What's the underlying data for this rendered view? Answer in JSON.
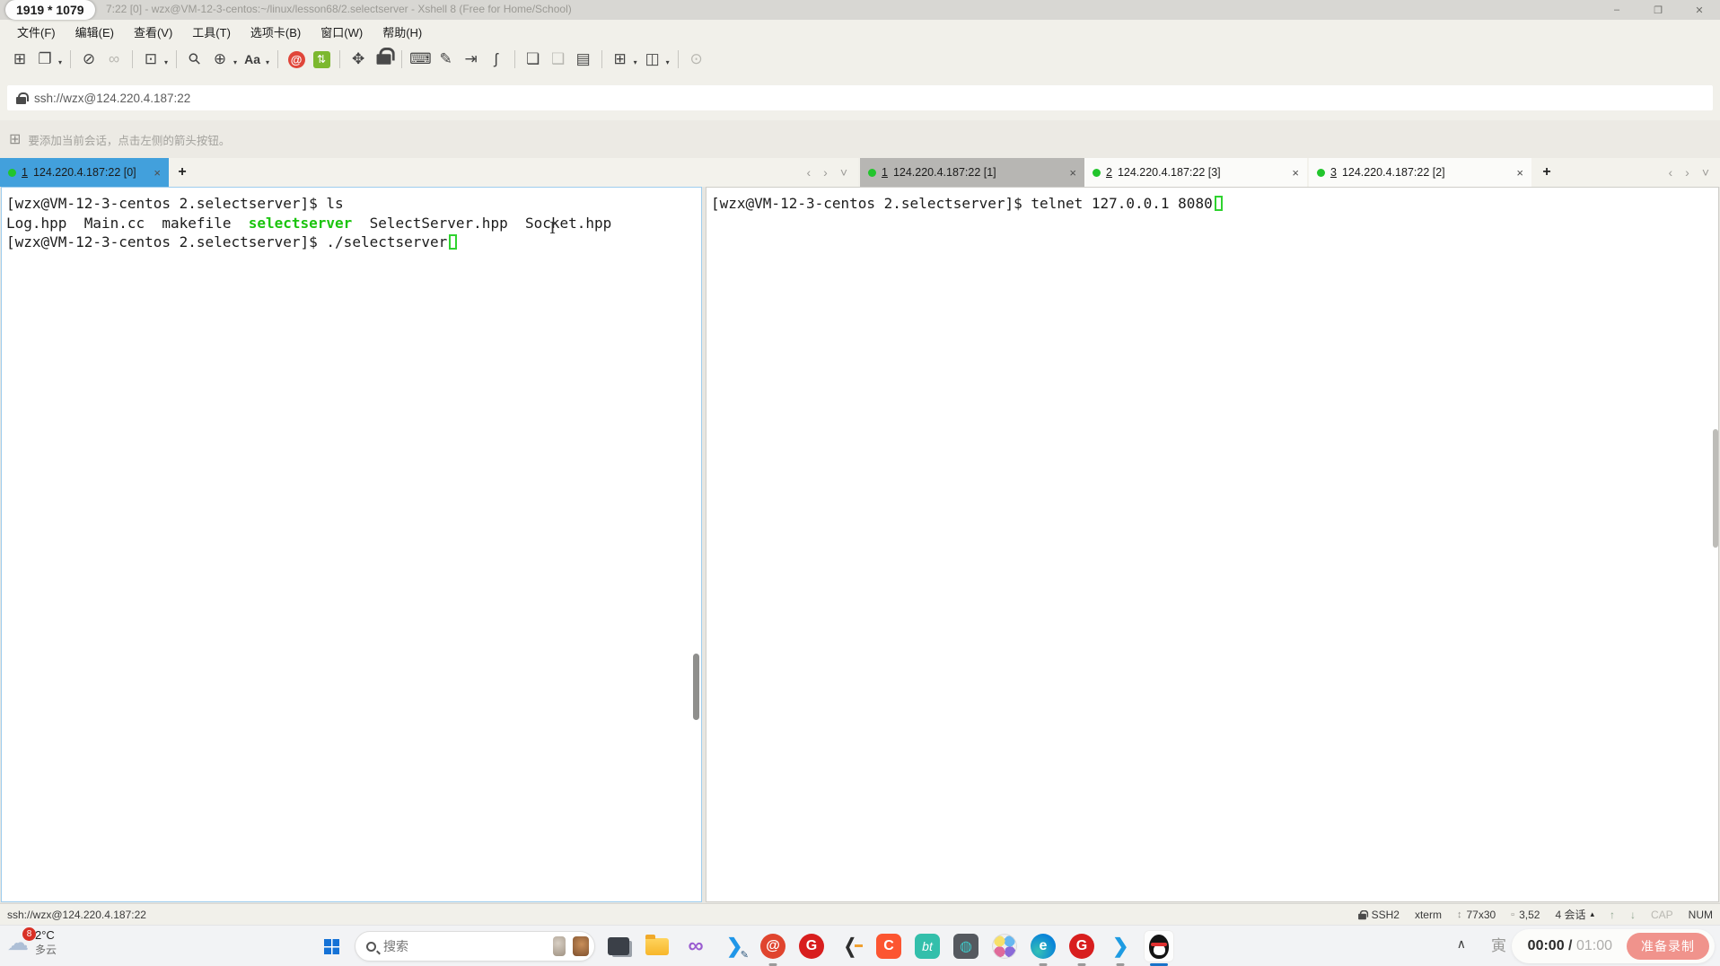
{
  "overlay": {
    "resolution_badge": "1919 * 1079"
  },
  "titlebar": {
    "title": "7:22 [0] - wzx@VM-12-3-centos:~/linux/lesson68/2.selectserver - Xshell 8 (Free for Home/School)",
    "minimize": "–",
    "restore": "❐",
    "close": "✕"
  },
  "menubar": {
    "items": [
      "文件(F)",
      "编辑(E)",
      "查看(V)",
      "工具(T)",
      "选项卡(B)",
      "窗口(W)",
      "帮助(H)"
    ]
  },
  "toolbar": {
    "caret": "▾",
    "glyphs": {
      "new_session": "⊞",
      "open_sessions": "❐",
      "disconnect": "⊘",
      "reconnect": "∞",
      "session_dialog": "⊡",
      "find": "⚲",
      "encoding": "⊕",
      "font": "Aa",
      "xshell_logo": "@",
      "xftp": "⇅",
      "fullscreen": "✥",
      "keyboard": "⌨",
      "highlight": "✎",
      "send_text": "⇥",
      "scroll": "ʃ",
      "log_start": "❏",
      "log_stop": "❑",
      "log_view": "▤",
      "new_tab_group": "⊞",
      "split_layout": "◫",
      "chat": "⊙"
    }
  },
  "addressbar": {
    "url": "ssh://wzx@124.220.4.187:22"
  },
  "infobar": {
    "icon_glyph": "⊞",
    "text": "要添加当前会话，点击左侧的箭头按钮。"
  },
  "tab_nav": {
    "add": "+",
    "close": "×",
    "prev": "‹",
    "next": "›",
    "menu": "˅"
  },
  "left_group": {
    "tabs": [
      {
        "num": "1",
        "label": "124.220.4.187:22 [0]"
      }
    ],
    "terminal": {
      "line1": "[wzx@VM-12-3-centos 2.selectserver]$ ls",
      "line2_pre": "Log.hpp  Main.cc  makefile  ",
      "line2_green": "selectserver",
      "line2_post": "  SelectServer.hpp  Socket.hpp",
      "line3": "[wzx@VM-12-3-centos 2.selectserver]$ ./selectserver"
    }
  },
  "right_group": {
    "tabs": [
      {
        "num": "1",
        "label": "124.220.4.187:22 [1]"
      },
      {
        "num": "2",
        "label": "124.220.4.187:22 [3]"
      },
      {
        "num": "3",
        "label": "124.220.4.187:22 [2]"
      }
    ],
    "terminal": {
      "line1": "[wzx@VM-12-3-centos 2.selectserver]$ telnet 127.0.0.1 8080"
    }
  },
  "statusbar": {
    "url": "ssh://wzx@124.220.4.187:22",
    "protocol": "SSH2",
    "terminal_type": "xterm",
    "screen_size": "77x30",
    "cursor_position": "3,52",
    "session_count": "4 会话",
    "caret": "▴",
    "font_up": "↑",
    "font_down": "↓",
    "caps": "CAP",
    "num": "NUM",
    "icons": {
      "resize": "↕",
      "position": "▫"
    }
  },
  "taskbar": {
    "weather": {
      "badge": "8",
      "temperature": "2°C",
      "condition": "多云",
      "cloud_glyph": "☁"
    },
    "search": {
      "placeholder": "搜索"
    },
    "icons": {
      "visual_studio": "∞",
      "vscode_pencil": "❮",
      "pencil": "✎",
      "xshell": "@",
      "gitee": "G",
      "leetcode": "❬",
      "csdn": "C",
      "baota": "bt",
      "dark_app": "◍",
      "edge": "e",
      "vscode": "❮",
      "tray_chevron": "∧",
      "ime": "寅"
    },
    "recording": {
      "elapsed": "00:00",
      "divider": "/",
      "total": "01:00",
      "button_label": "准备录制"
    }
  },
  "colors": {
    "active_tab_blue": "#42a0dc",
    "inactive_active_tab_gray": "#b7b6b3",
    "terminal_green": "#1bc40e",
    "cursor_green": "#2fd32f",
    "session_dot_green": "#22c52c",
    "record_button_pink": "#f0938c",
    "taskbar_active_dash_blue": "#1a73c9"
  }
}
